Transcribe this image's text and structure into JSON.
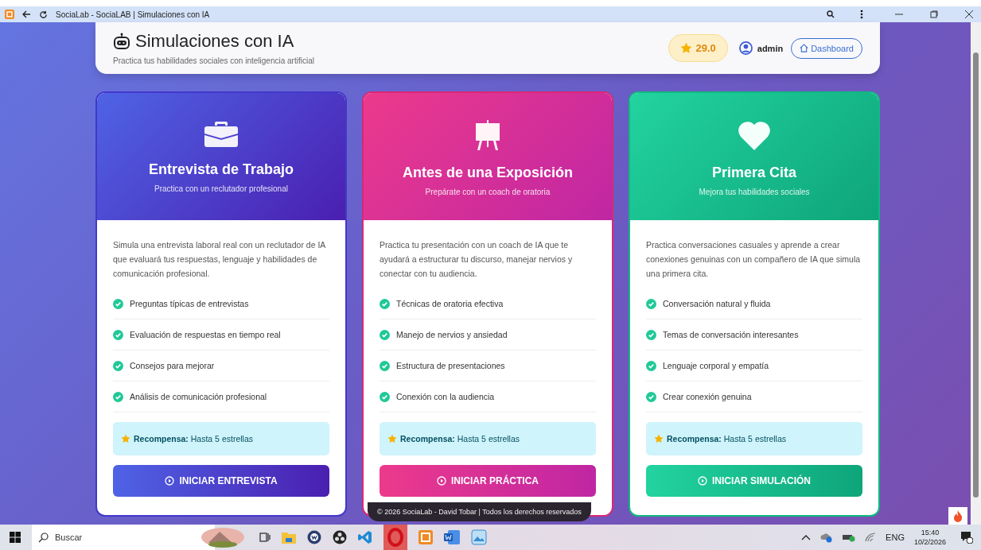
{
  "browser": {
    "tab_title": "SociaLab - SociaLAB | Simulaciones con IA"
  },
  "header": {
    "title": "Simulaciones con IA",
    "subtitle": "Practica tus habilidades sociales con inteligencia artificial",
    "points": "29.0",
    "user": "admin",
    "dashboard": "Dashboard"
  },
  "cards": [
    {
      "kind": "briefcase",
      "color": "#4338ca",
      "title": "Entrevista de Trabajo",
      "subtitle": "Practica con un reclutador profesional",
      "description": "Simula una entrevista laboral real con un reclutador de IA que evaluará tus respuestas, lenguaje y habilidades de comunicación profesional.",
      "features": [
        "Preguntas típicas de entrevistas",
        "Evaluación de respuestas en tiempo real",
        "Consejos para mejorar",
        "Análisis de comunicación profesional"
      ],
      "reward": "**Recompensa:** Hasta 5 estrellas",
      "button": "INICIAR ENTREVISTA"
    },
    {
      "kind": "easel",
      "color": "#db2777",
      "title": "Antes de una Exposición",
      "subtitle": "Prepárate con un coach de oratoria",
      "description": "Practica tu presentación con un coach de IA que te ayudará a estructurar tu discurso, manejar nervios y conectar con tu audiencia.",
      "features": [
        "Técnicas de oratoria efectiva",
        "Manejo de nervios y ansiedad",
        "Estructura de presentaciones",
        "Conexión con la audiencia"
      ],
      "reward": "**Recompensa:** Hasta 5 estrellas",
      "button": "INICIAR PRÁCTICA"
    },
    {
      "kind": "heart",
      "color": "#10b981",
      "title": "Primera Cita",
      "subtitle": "Mejora tus habilidades sociales",
      "description": "Practica conversaciones casuales y aprende a crear conexiones genuinas con un compañero de IA que simula una primera cita.",
      "features": [
        "Conversación natural y fluida",
        "Temas de conversación interesantes",
        "Lenguaje corporal y empatía",
        "Crear conexión genuina"
      ],
      "reward": "**Recompensa:** Hasta 5 estrellas",
      "button": "INICIAR SIMULACIÓN"
    }
  ],
  "footer": "© 2026 SociaLab - David Tobar | Todos los derechos reservados",
  "taskbar": {
    "search_placeholder": "Buscar",
    "language": "ENG",
    "time": "15:40",
    "date": "10/2/2026"
  }
}
